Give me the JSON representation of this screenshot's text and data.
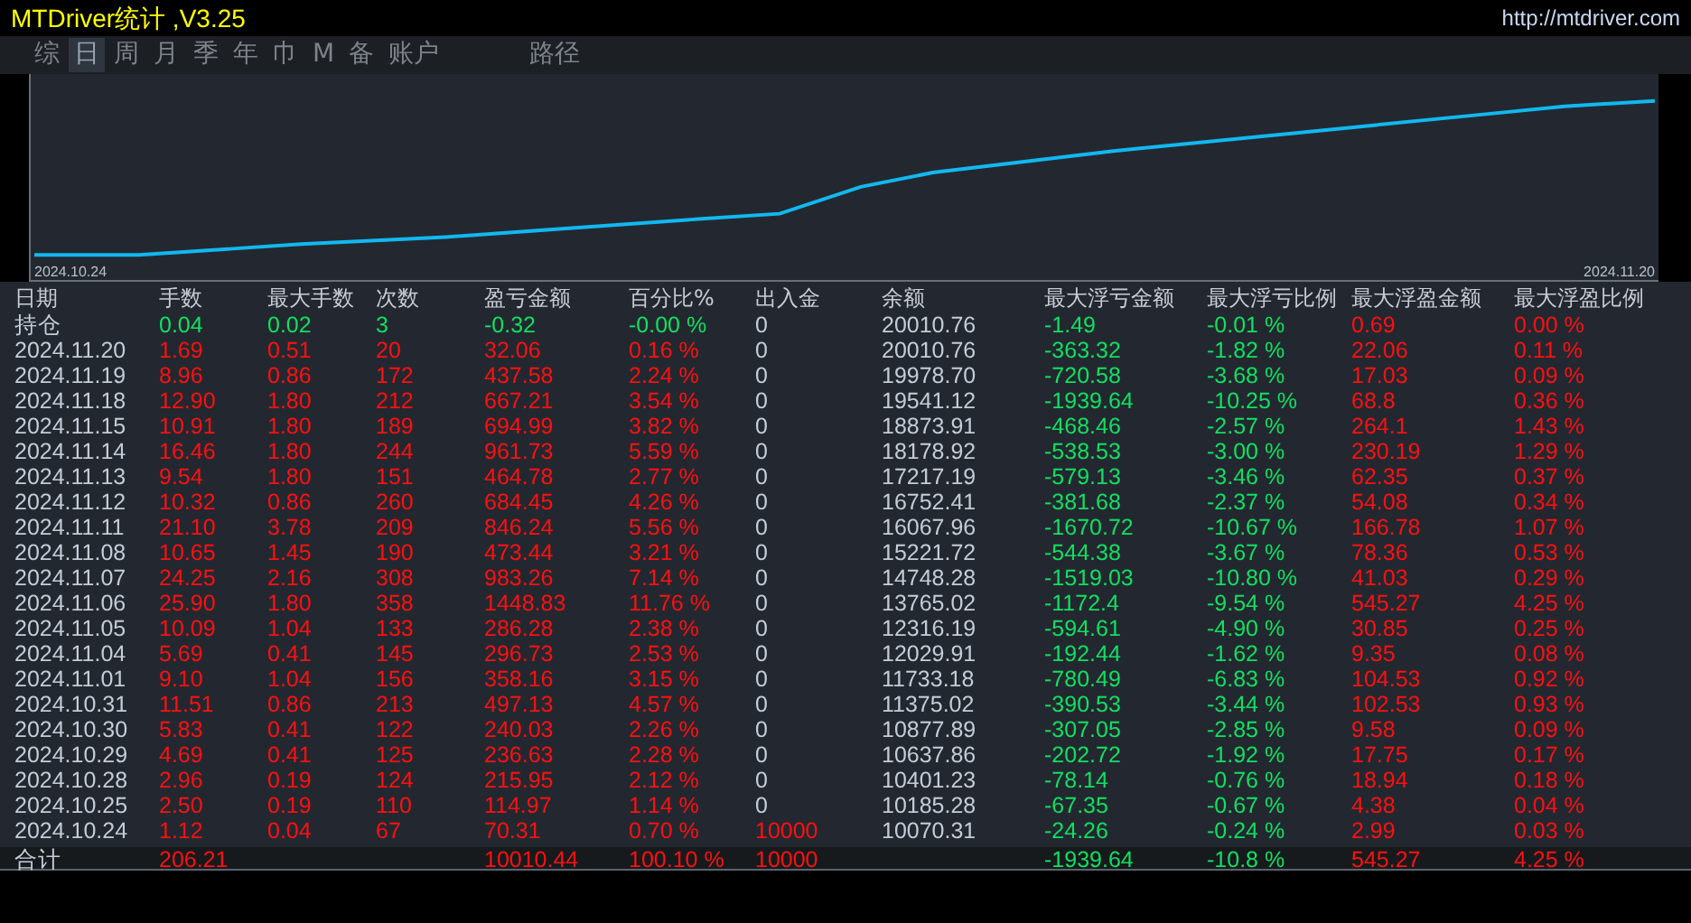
{
  "window": {
    "title": "MTDriver统计 ,V3.25",
    "url": "http://mtdriver.com"
  },
  "tabs": [
    {
      "label": "综",
      "selected": false
    },
    {
      "label": "日",
      "selected": true
    },
    {
      "label": "周",
      "selected": false
    },
    {
      "label": "月",
      "selected": false
    },
    {
      "label": "季",
      "selected": false
    },
    {
      "label": "年",
      "selected": false
    },
    {
      "label": "巾",
      "selected": false
    },
    {
      "label": "M",
      "selected": false
    },
    {
      "label": "备",
      "selected": false
    },
    {
      "label": "账户",
      "selected": false
    },
    {
      "label": "路径",
      "selected": false
    }
  ],
  "chart": {
    "start_label": "2024.10.24",
    "end_label": "2024.11.20"
  },
  "table": {
    "columns": [
      {
        "label": "日期",
        "kind": "date"
      },
      {
        "label": "手数",
        "kind": "result"
      },
      {
        "label": "最大手数",
        "kind": "result"
      },
      {
        "label": "次数",
        "kind": "result"
      },
      {
        "label": "盈亏金额",
        "kind": "result"
      },
      {
        "label": "百分比%",
        "kind": "result"
      },
      {
        "label": "出入金",
        "kind": "flow"
      },
      {
        "label": "余额",
        "kind": "plain"
      },
      {
        "label": "最大浮亏金额",
        "kind": "loss"
      },
      {
        "label": "最大浮亏比例",
        "kind": "loss"
      },
      {
        "label": "最大浮盈金额",
        "kind": "gain"
      },
      {
        "label": "最大浮盈比例",
        "kind": "gain"
      }
    ],
    "rows": [
      {
        "kind": "open",
        "deposit": false,
        "cells": [
          "持仓",
          "0.04",
          "0.02",
          "3",
          "-0.32",
          "-0.00 %",
          "0",
          "20010.76",
          "-1.49",
          "-0.01 %",
          "0.69",
          "0.00 %"
        ]
      },
      {
        "kind": "day",
        "deposit": false,
        "cells": [
          "2024.11.20",
          "1.69",
          "0.51",
          "20",
          "32.06",
          "0.16 %",
          "0",
          "20010.76",
          "-363.32",
          "-1.82 %",
          "22.06",
          "0.11 %"
        ]
      },
      {
        "kind": "day",
        "deposit": false,
        "cells": [
          "2024.11.19",
          "8.96",
          "0.86",
          "172",
          "437.58",
          "2.24 %",
          "0",
          "19978.70",
          "-720.58",
          "-3.68 %",
          "17.03",
          "0.09 %"
        ]
      },
      {
        "kind": "day",
        "deposit": false,
        "cells": [
          "2024.11.18",
          "12.90",
          "1.80",
          "212",
          "667.21",
          "3.54 %",
          "0",
          "19541.12",
          "-1939.64",
          "-10.25 %",
          "68.8",
          "0.36 %"
        ]
      },
      {
        "kind": "day",
        "deposit": false,
        "cells": [
          "2024.11.15",
          "10.91",
          "1.80",
          "189",
          "694.99",
          "3.82 %",
          "0",
          "18873.91",
          "-468.46",
          "-2.57 %",
          "264.1",
          "1.43 %"
        ]
      },
      {
        "kind": "day",
        "deposit": false,
        "cells": [
          "2024.11.14",
          "16.46",
          "1.80",
          "244",
          "961.73",
          "5.59 %",
          "0",
          "18178.92",
          "-538.53",
          "-3.00 %",
          "230.19",
          "1.29 %"
        ]
      },
      {
        "kind": "day",
        "deposit": false,
        "cells": [
          "2024.11.13",
          "9.54",
          "1.80",
          "151",
          "464.78",
          "2.77 %",
          "0",
          "17217.19",
          "-579.13",
          "-3.46 %",
          "62.35",
          "0.37 %"
        ]
      },
      {
        "kind": "day",
        "deposit": false,
        "cells": [
          "2024.11.12",
          "10.32",
          "0.86",
          "260",
          "684.45",
          "4.26 %",
          "0",
          "16752.41",
          "-381.68",
          "-2.37 %",
          "54.08",
          "0.34 %"
        ]
      },
      {
        "kind": "day",
        "deposit": false,
        "cells": [
          "2024.11.11",
          "21.10",
          "3.78",
          "209",
          "846.24",
          "5.56 %",
          "0",
          "16067.96",
          "-1670.72",
          "-10.67 %",
          "166.78",
          "1.07 %"
        ]
      },
      {
        "kind": "day",
        "deposit": false,
        "cells": [
          "2024.11.08",
          "10.65",
          "1.45",
          "190",
          "473.44",
          "3.21 %",
          "0",
          "15221.72",
          "-544.38",
          "-3.67 %",
          "78.36",
          "0.53 %"
        ]
      },
      {
        "kind": "day",
        "deposit": false,
        "cells": [
          "2024.11.07",
          "24.25",
          "2.16",
          "308",
          "983.26",
          "7.14 %",
          "0",
          "14748.28",
          "-1519.03",
          "-10.80 %",
          "41.03",
          "0.29 %"
        ]
      },
      {
        "kind": "day",
        "deposit": false,
        "cells": [
          "2024.11.06",
          "25.90",
          "1.80",
          "358",
          "1448.83",
          "11.76 %",
          "0",
          "13765.02",
          "-1172.4",
          "-9.54 %",
          "545.27",
          "4.25 %"
        ]
      },
      {
        "kind": "day",
        "deposit": false,
        "cells": [
          "2024.11.05",
          "10.09",
          "1.04",
          "133",
          "286.28",
          "2.38 %",
          "0",
          "12316.19",
          "-594.61",
          "-4.90 %",
          "30.85",
          "0.25 %"
        ]
      },
      {
        "kind": "day",
        "deposit": false,
        "cells": [
          "2024.11.04",
          "5.69",
          "0.41",
          "145",
          "296.73",
          "2.53 %",
          "0",
          "12029.91",
          "-192.44",
          "-1.62 %",
          "9.35",
          "0.08 %"
        ]
      },
      {
        "kind": "day",
        "deposit": false,
        "cells": [
          "2024.11.01",
          "9.10",
          "1.04",
          "156",
          "358.16",
          "3.15 %",
          "0",
          "11733.18",
          "-780.49",
          "-6.83 %",
          "104.53",
          "0.92 %"
        ]
      },
      {
        "kind": "day",
        "deposit": false,
        "cells": [
          "2024.10.31",
          "11.51",
          "0.86",
          "213",
          "497.13",
          "4.57 %",
          "0",
          "11375.02",
          "-390.53",
          "-3.44 %",
          "102.53",
          "0.93 %"
        ]
      },
      {
        "kind": "day",
        "deposit": false,
        "cells": [
          "2024.10.30",
          "5.83",
          "0.41",
          "122",
          "240.03",
          "2.26 %",
          "0",
          "10877.89",
          "-307.05",
          "-2.85 %",
          "9.58",
          "0.09 %"
        ]
      },
      {
        "kind": "day",
        "deposit": false,
        "cells": [
          "2024.10.29",
          "4.69",
          "0.41",
          "125",
          "236.63",
          "2.28 %",
          "0",
          "10637.86",
          "-202.72",
          "-1.92 %",
          "17.75",
          "0.17 %"
        ]
      },
      {
        "kind": "day",
        "deposit": false,
        "cells": [
          "2024.10.28",
          "2.96",
          "0.19",
          "124",
          "215.95",
          "2.12 %",
          "0",
          "10401.23",
          "-78.14",
          "-0.76 %",
          "18.94",
          "0.18 %"
        ]
      },
      {
        "kind": "day",
        "deposit": false,
        "cells": [
          "2024.10.25",
          "2.50",
          "0.19",
          "110",
          "114.97",
          "1.14 %",
          "0",
          "10185.28",
          "-67.35",
          "-0.67 %",
          "4.38",
          "0.04 %"
        ]
      },
      {
        "kind": "day",
        "deposit": true,
        "cells": [
          "2024.10.24",
          "1.12",
          "0.04",
          "67",
          "70.31",
          "0.70 %",
          "10000",
          "10070.31",
          "-24.26",
          "-0.24 %",
          "2.99",
          "0.03 %"
        ]
      },
      {
        "kind": "total",
        "deposit": true,
        "cells": [
          "合计",
          "206.21",
          null,
          null,
          "10010.44",
          "100.10 %",
          "10000",
          null,
          "-1939.64",
          "-10.8 %",
          "545.27",
          "4.25 %"
        ]
      }
    ]
  }
}
